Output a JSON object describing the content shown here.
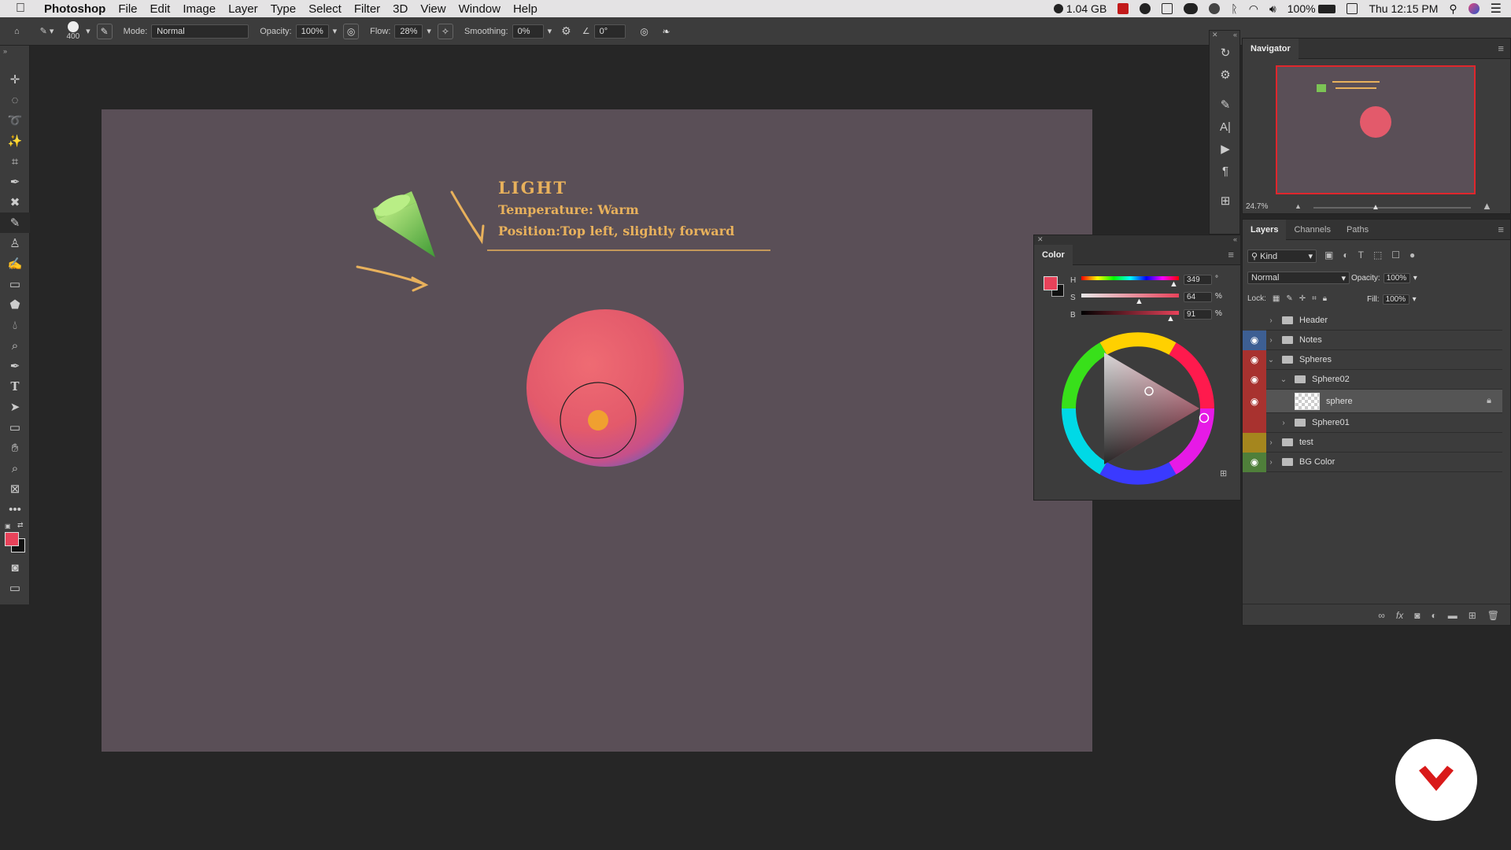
{
  "menubar": {
    "app": "Photoshop",
    "items": [
      "File",
      "Edit",
      "Image",
      "Layer",
      "Type",
      "Select",
      "Filter",
      "3D",
      "View",
      "Window",
      "Help"
    ],
    "memory": "1.04 GB",
    "battery": "100%",
    "clock": "Thu 12:15 PM"
  },
  "options": {
    "brush_size": "400",
    "mode_label": "Mode:",
    "mode_value": "Normal",
    "opacity_label": "Opacity:",
    "opacity_value": "100%",
    "flow_label": "Flow:",
    "flow_value": "28%",
    "smoothing_label": "Smoothing:",
    "smoothing_value": "0%",
    "angle_value": "0°"
  },
  "canvas": {
    "bg_color": "#5a4f57",
    "note_title": "LIGHT",
    "note_line1": "Temperature: Warm",
    "note_line2": "Position:Top left, slightly forward",
    "note_color": "#e8b15c",
    "sphere_color": "#e35a6b"
  },
  "navigator": {
    "title": "Navigator",
    "zoom": "24.7%"
  },
  "color_panel": {
    "title": "Color",
    "h_label": "H",
    "h_value": "349",
    "h_unit": "°",
    "s_label": "S",
    "s_value": "64",
    "s_unit": "%",
    "b_label": "B",
    "b_value": "91",
    "b_unit": "%",
    "foreground": "#e8425a"
  },
  "layers_panel": {
    "tabs": [
      "Layers",
      "Channels",
      "Paths"
    ],
    "filter_label": "Kind",
    "blend_mode": "Normal",
    "opacity_label": "Opacity:",
    "opacity_value": "100%",
    "lock_label": "Lock:",
    "fill_label": "Fill:",
    "fill_value": "100%",
    "layers": [
      {
        "name": "Header",
        "visible": false,
        "tag_color": "#3c3c3c"
      },
      {
        "name": "Notes",
        "visible": true,
        "tag_color": "#3d5f93"
      },
      {
        "name": "Spheres",
        "visible": true,
        "tag_color": "#a8322f"
      },
      {
        "name": "Sphere02",
        "visible": true,
        "tag_color": "#a8322f"
      },
      {
        "name": "sphere",
        "visible": true,
        "tag_color": "#a8322f"
      },
      {
        "name": "Sphere01",
        "visible": false,
        "tag_color": "#a8322f"
      },
      {
        "name": "test",
        "visible": false,
        "tag_color": "#a5861e"
      },
      {
        "name": "BG Color",
        "visible": true,
        "tag_color": "#4f7f3a"
      }
    ]
  }
}
